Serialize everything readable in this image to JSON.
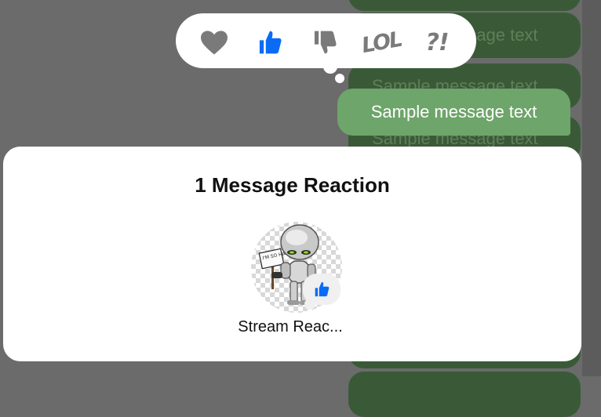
{
  "background_messages": [
    {
      "text": ""
    },
    {
      "text": "Sample message text"
    },
    {
      "text": "Sample message text"
    },
    {
      "text": "Sample message text"
    },
    {
      "text": ""
    },
    {
      "text": ""
    }
  ],
  "selected_message": {
    "text": "Sample message text"
  },
  "reaction_picker": {
    "options": [
      {
        "id": "love",
        "icon": "heart-icon",
        "selected": false
      },
      {
        "id": "like",
        "icon": "thumbs-up-icon",
        "selected": true
      },
      {
        "id": "sad",
        "icon": "thumbs-down-icon",
        "selected": false
      },
      {
        "id": "haha",
        "label": "LOL",
        "selected": false
      },
      {
        "id": "wow",
        "label": "?!",
        "selected": false
      }
    ]
  },
  "sheet": {
    "title": "1 Message Reaction",
    "reactions": [
      {
        "user_name": "Stream Reac...",
        "reaction_icon": "thumbs-up-icon",
        "avatar_caption": "I'M SO HAPPY"
      }
    ]
  },
  "colors": {
    "accent_blue": "#0a6cf5",
    "own_bubble": "#6ea56a",
    "dimmed_bubble": "#3a5a37",
    "overlay": "#6b6b6b",
    "icon_grey": "#7a7a7a"
  }
}
